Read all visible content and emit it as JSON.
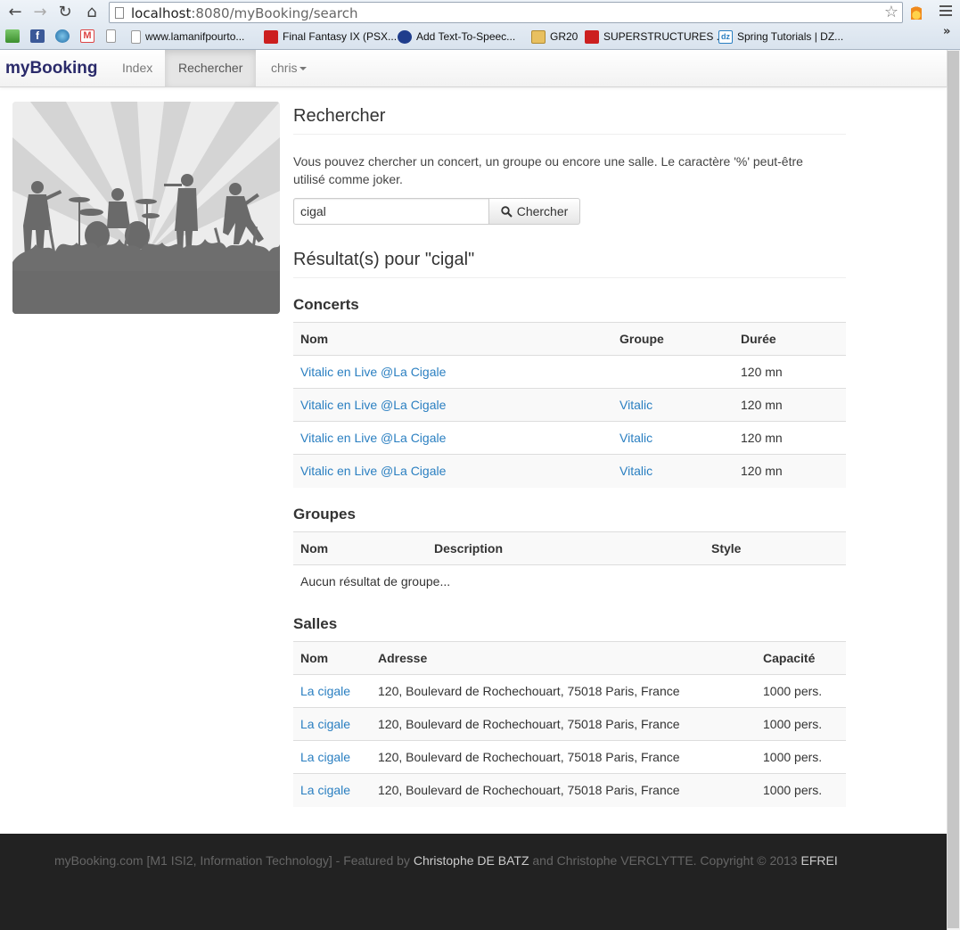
{
  "browser": {
    "url_host": "localhost",
    "url_path": ":8080/myBooking/search",
    "bookmarks": [
      {
        "label": "www.lamanifpourto...",
        "icon": "page-icon"
      },
      {
        "label": "Final Fantasy IX (PSX...",
        "icon": "youtube-icon",
        "color": "#cc1f1f"
      },
      {
        "label": "Add Text-To-Speec...",
        "icon": "speech-icon",
        "color": "#1f3d8c"
      },
      {
        "label": "GR20",
        "icon": "folder-icon",
        "color": "#e8c060"
      },
      {
        "label": "SUPERSTRUCTURES ...",
        "icon": "youtube-icon",
        "color": "#cc1f1f"
      },
      {
        "label": "Spring Tutorials | DZ...",
        "icon": "dzone-icon",
        "color": "#2a7fc1"
      }
    ],
    "chevron": "»"
  },
  "navbar": {
    "brand": "myBooking",
    "items": [
      "Index",
      "Rechercher",
      "chris"
    ],
    "active": "Rechercher"
  },
  "main": {
    "title": "Rechercher",
    "intro": "Vous pouvez chercher un concert, un groupe ou encore une salle. Le caractère '%' peut-être utilisé comme joker.",
    "search_value": "cigal",
    "search_button": "Chercher",
    "results_title": "Résultat(s) pour \"cigal\""
  },
  "concerts": {
    "title": "Concerts",
    "headers": [
      "Nom",
      "Groupe",
      "Durée"
    ],
    "rows": [
      {
        "nom": "Vitalic en Live @La Cigale",
        "groupe": "",
        "duree": "120 mn"
      },
      {
        "nom": "Vitalic en Live @La Cigale",
        "groupe": "Vitalic",
        "duree": "120 mn"
      },
      {
        "nom": "Vitalic en Live @La Cigale",
        "groupe": "Vitalic",
        "duree": "120 mn"
      },
      {
        "nom": "Vitalic en Live @La Cigale",
        "groupe": "Vitalic",
        "duree": "120 mn"
      }
    ]
  },
  "groupes": {
    "title": "Groupes",
    "headers": [
      "Nom",
      "Description",
      "Style"
    ],
    "empty": "Aucun résultat de groupe..."
  },
  "salles": {
    "title": "Salles",
    "headers": [
      "Nom",
      "Adresse",
      "Capacité"
    ],
    "rows": [
      {
        "nom": "La cigale",
        "adresse": "120, Boulevard de Rochechouart, 75018 Paris, France",
        "capacite": "1000 pers."
      },
      {
        "nom": "La cigale",
        "adresse": "120, Boulevard de Rochechouart, 75018 Paris, France",
        "capacite": "1000 pers."
      },
      {
        "nom": "La cigale",
        "adresse": "120, Boulevard de Rochechouart, 75018 Paris, France",
        "capacite": "1000 pers."
      },
      {
        "nom": "La cigale",
        "adresse": "120, Boulevard de Rochechouart, 75018 Paris, France",
        "capacite": "1000 pers."
      }
    ]
  },
  "footer": {
    "prefix": "myBooking.com [M1 ISI2, Information Technology] - Featured by ",
    "author1": "Christophe DE BATZ",
    "middle": " and Christophe VERCLYTTE. Copyright © 2013 ",
    "org": "EFREI"
  },
  "colors": {
    "link": "#2a7fc1",
    "brand": "#2a2a6a",
    "footer_bg": "#222222"
  }
}
